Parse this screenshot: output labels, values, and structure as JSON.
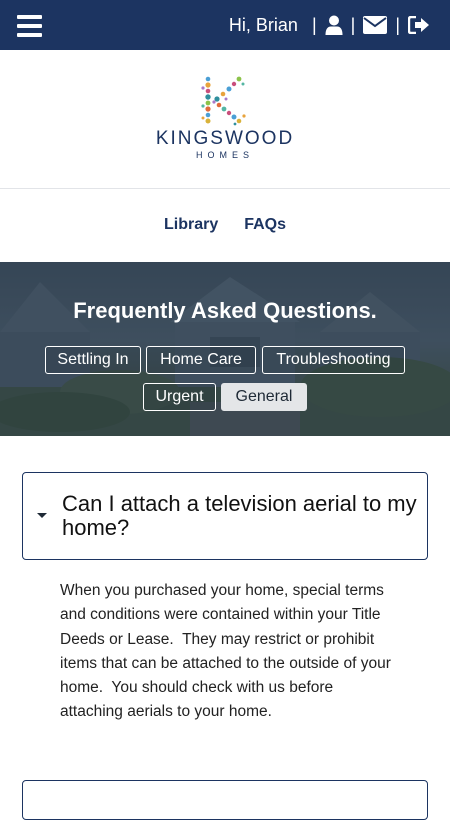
{
  "header": {
    "greeting": "Hi, Brian",
    "separator": "|",
    "icons": [
      "menu-icon",
      "user-icon",
      "envelope-icon",
      "sign-out-icon"
    ]
  },
  "brand": {
    "name": "KINGSWOOD",
    "sub": "HOMES",
    "color": "#1c3461"
  },
  "nav": {
    "library": "Library",
    "faqs": "FAQs"
  },
  "hero": {
    "title": "Frequently Asked Questions.",
    "categories": {
      "settling_in": "Settling In",
      "home_care": "Home Care",
      "troubleshooting": "Troubleshooting",
      "urgent": "Urgent",
      "general": "General"
    },
    "active_category": "General"
  },
  "faq": {
    "question": "Can I attach a television aerial to my home?",
    "answer": "When you purchased your home, special terms and conditions were contained within your Title Deeds or Lease.  They may restrict or prohibit items that can be attached to the outside of your home.  You should check with us before attaching aerials to your home."
  }
}
